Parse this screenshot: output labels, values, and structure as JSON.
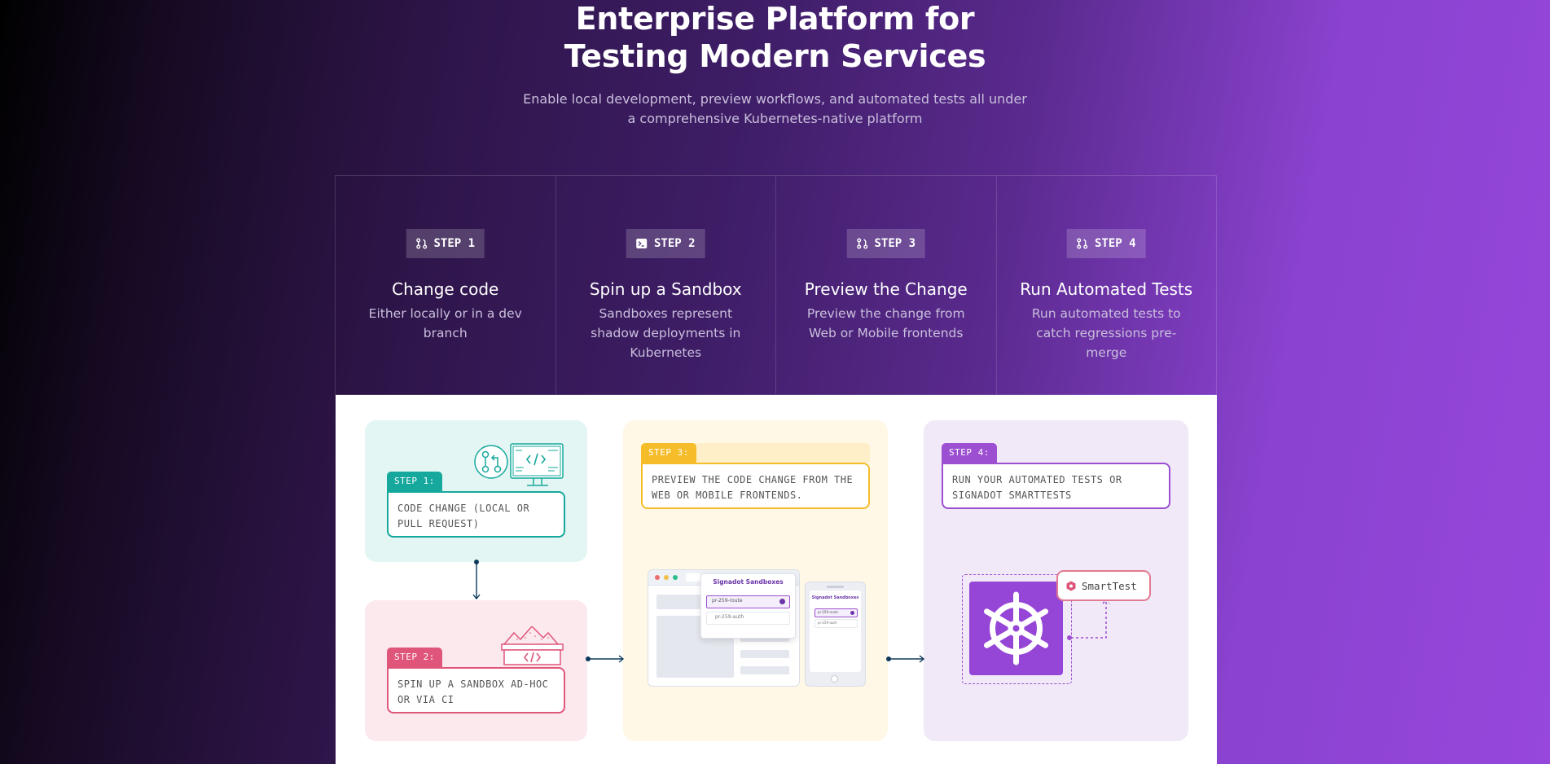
{
  "hero": {
    "title_line1": "Enterprise Platform for",
    "title_line2": "Testing Modern Services",
    "subtitle_line1": "Enable local development, preview workflows, and automated tests all under",
    "subtitle_line2": "a comprehensive Kubernetes-native platform"
  },
  "steps": [
    {
      "badge": "STEP 1",
      "icon": "branch-icon",
      "title": "Change code",
      "desc": "Either locally or in a dev branch"
    },
    {
      "badge": "STEP 2",
      "icon": "terminal-icon",
      "title": "Spin up a Sandbox",
      "desc": "Sandboxes represent shadow deployments in Kubernetes"
    },
    {
      "badge": "STEP 3",
      "icon": "branch-icon",
      "title": "Preview the Change",
      "desc": "Preview the change from Web or Mobile frontends"
    },
    {
      "badge": "STEP 4",
      "icon": "branch-icon",
      "title": "Run Automated Tests",
      "desc": "Run automated tests to catch regressions pre-merge"
    }
  ],
  "diagram": {
    "step1": {
      "tag": "STEP 1:",
      "line1": "CODE CHANGE (LOCAL OR",
      "line2": "PULL REQUEST)"
    },
    "step2": {
      "tag": "STEP 2:",
      "line1": "SPIN UP A SANDBOX AD-HOC",
      "line2": "OR VIA CI"
    },
    "step3": {
      "tag": "STEP 3:",
      "line1": "PREVIEW THE CODE CHANGE FROM THE",
      "line2": "WEB OR MOBILE FRONTENDS."
    },
    "step4": {
      "tag": "STEP 4:",
      "line1": "RUN YOUR AUTOMATED TESTS OR",
      "line2": "SIGNADOT SMARTTESTS"
    },
    "browser": {
      "header": "Signadot Sandboxes",
      "item1": "pr-259-route",
      "item2": "pr-259-auth"
    },
    "mobile": {
      "header": "Signadot Sandboxes",
      "item1": "pr-259-route",
      "item2": "pr-259-auth"
    },
    "smart_test_label": "SmartTest"
  },
  "colors": {
    "teal": "#16a89c",
    "pink": "#e0557a",
    "yellow": "#f5bd2a",
    "purple": "#9c4fd1",
    "navy": "#0e3a5c"
  }
}
